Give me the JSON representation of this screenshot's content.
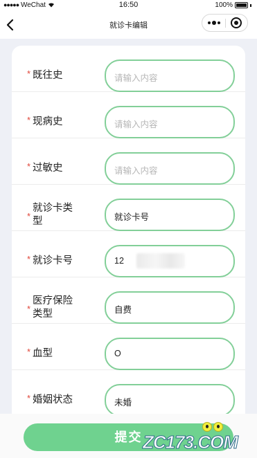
{
  "status_bar": {
    "signal": "●●●●●",
    "carrier": "WeChat",
    "time": "16:50",
    "battery": "100%"
  },
  "nav": {
    "title": "就诊卡编辑"
  },
  "form": {
    "required_mark": "*",
    "rows": [
      {
        "label": "既往史",
        "placeholder": "请输入内容",
        "value": ""
      },
      {
        "label": "现病史",
        "placeholder": "请输入内容",
        "value": ""
      },
      {
        "label": "过敏史",
        "placeholder": "请输入内容",
        "value": ""
      },
      {
        "label": "就诊卡类型",
        "placeholder": "",
        "value": "就诊卡号"
      },
      {
        "label": "就诊卡号",
        "placeholder": "",
        "value": "12"
      },
      {
        "label": "医疗保险类型",
        "placeholder": "",
        "value": "自费"
      },
      {
        "label": "血型",
        "placeholder": "",
        "value": "O"
      },
      {
        "label": "婚姻状态",
        "placeholder": "",
        "value": "未婚"
      }
    ]
  },
  "submit_label": "提交",
  "watermark": "ZC173.COM",
  "colors": {
    "accent": "#6fd28f",
    "field_border": "#82cf98",
    "required": "#e0463a",
    "background": "#eef0f6"
  }
}
